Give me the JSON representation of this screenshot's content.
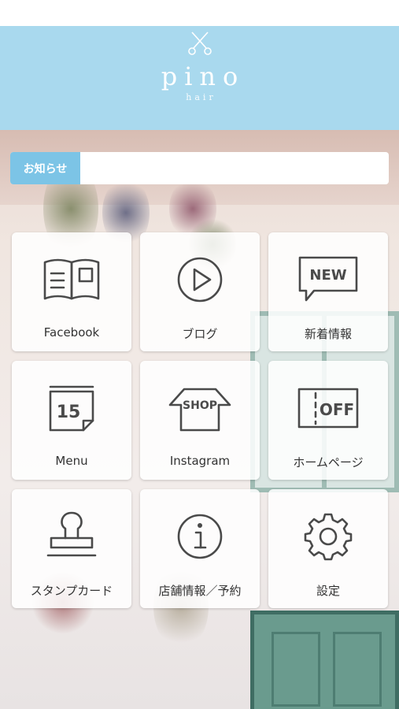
{
  "header": {
    "logo_text": "pino",
    "logo_sub": "hair",
    "background_color": "#a9d9ee"
  },
  "notice": {
    "label": "お知らせ",
    "text": "",
    "label_color": "#7cc4e6"
  },
  "menu": {
    "tiles": [
      {
        "label": "Facebook",
        "icon": "book-icon"
      },
      {
        "label": "ブログ",
        "icon": "play-icon"
      },
      {
        "label": "新着情報",
        "icon": "new-speech-icon",
        "icon_text": "NEW"
      },
      {
        "label": "Menu",
        "icon": "calendar-icon",
        "icon_text": "15"
      },
      {
        "label": "Instagram",
        "icon": "shop-icon",
        "icon_text": "SHOP"
      },
      {
        "label": "ホームページ",
        "icon": "coupon-icon",
        "icon_text": "OFF"
      },
      {
        "label": "スタンプカード",
        "icon": "stamp-icon"
      },
      {
        "label": "店舗情報／予約",
        "icon": "info-icon"
      },
      {
        "label": "設定",
        "icon": "gear-icon"
      }
    ]
  }
}
